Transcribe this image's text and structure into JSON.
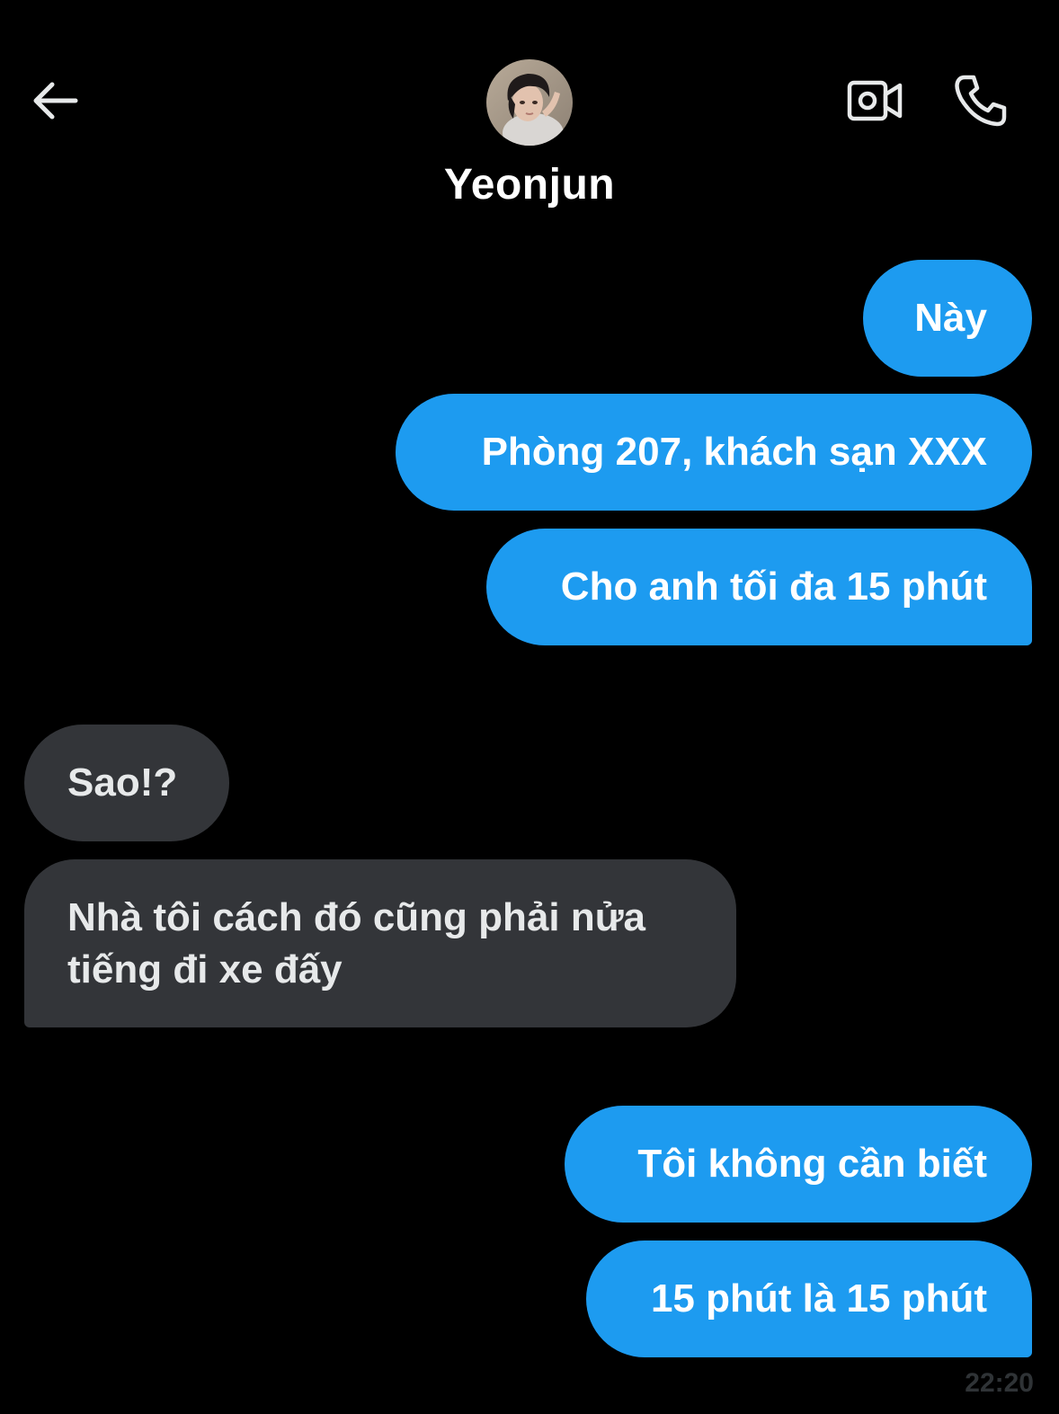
{
  "header": {
    "contact_name": "Yeonjun",
    "back_icon": "arrow-left-icon",
    "video_icon": "video-camera-icon",
    "call_icon": "phone-icon"
  },
  "messages": [
    {
      "direction": "sent",
      "text": "Này"
    },
    {
      "direction": "sent",
      "text": "Phòng 207, khách sạn XXX"
    },
    {
      "direction": "sent",
      "text": "Cho anh tối đa 15 phút"
    },
    {
      "direction": "received",
      "text": "Sao!?"
    },
    {
      "direction": "received",
      "text": "Nhà tôi cách đó cũng phải nửa tiếng đi xe đấy"
    },
    {
      "direction": "sent",
      "text": "Tôi không cần biết"
    },
    {
      "direction": "sent",
      "text": "15 phút là 15 phút"
    }
  ],
  "last_timestamp": "22:20",
  "colors": {
    "background": "#000000",
    "sent_bubble": "#1d9bf0",
    "received_bubble": "#333539",
    "text": "#ffffff"
  }
}
